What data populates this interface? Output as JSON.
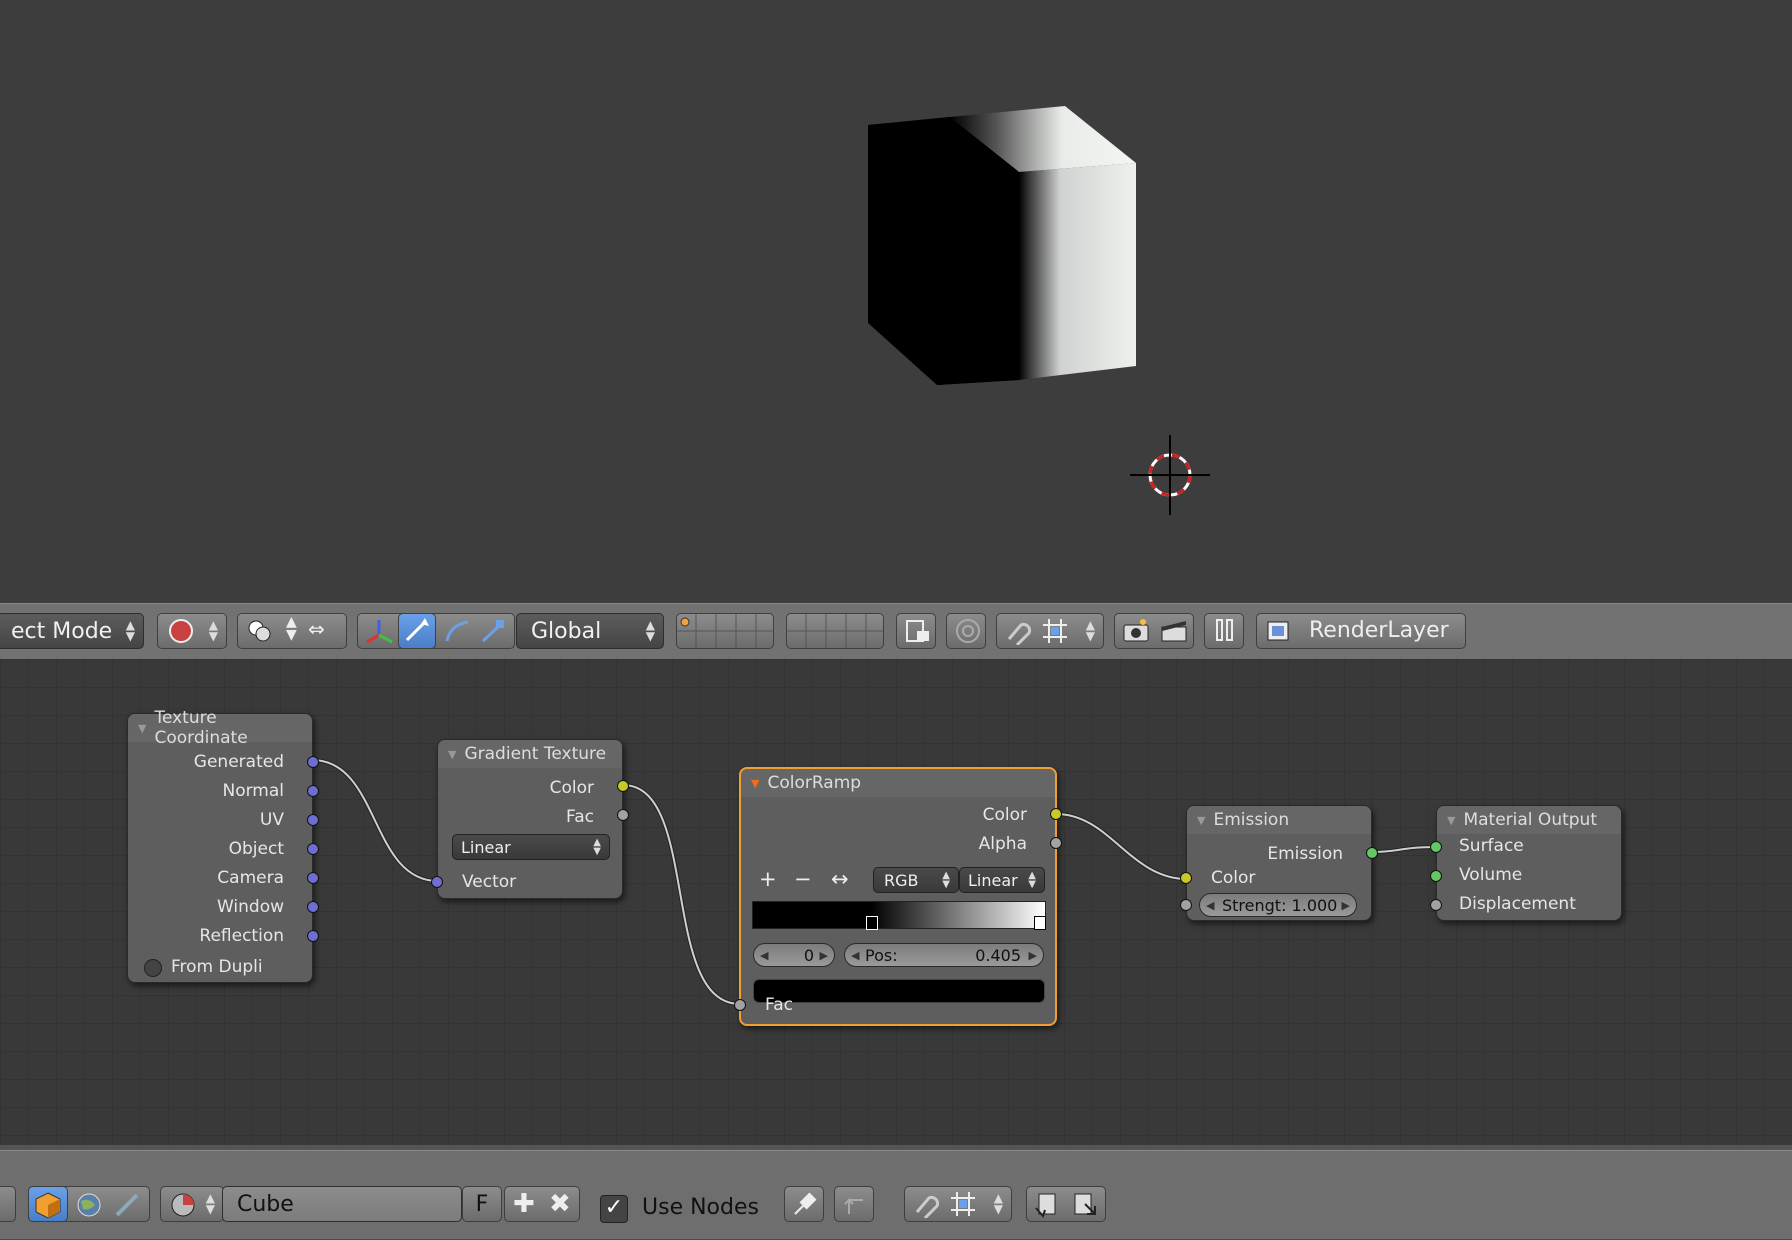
{
  "viewport": {
    "name": "3D Viewport"
  },
  "header3d": {
    "mode": "ect Mode",
    "orientation": "Global",
    "render_layer": "RenderLayer"
  },
  "nodes": {
    "texcoord": {
      "title": "Texture Coordinate",
      "outputs": [
        "Generated",
        "Normal",
        "UV",
        "Object",
        "Camera",
        "Window",
        "Reflection"
      ],
      "from_dupli": "From Dupli"
    },
    "gradient": {
      "title": "Gradient Texture",
      "outputs": [
        "Color",
        "Fac"
      ],
      "type": "Linear",
      "input": "Vector"
    },
    "colorramp": {
      "title": "ColorRamp",
      "outputs": [
        "Color",
        "Alpha"
      ],
      "add": "+",
      "remove": "−",
      "flip": "↔",
      "color_mode": "RGB",
      "interpolation": "Linear",
      "index": "0",
      "pos_label": "Pos:",
      "pos_value": "0.405",
      "input": "Fac",
      "stop_position": 0.405
    },
    "emission": {
      "title": "Emission",
      "output": "Emission",
      "input_color": "Color",
      "strength": "Strengt: 1.000"
    },
    "output": {
      "title": "Material Output",
      "inputs": [
        "Surface",
        "Volume",
        "Displacement"
      ]
    }
  },
  "node_header": {
    "material": "Cube",
    "fake_user": "F",
    "use_nodes": "Use Nodes"
  },
  "colors": {
    "vector_socket": "#6e6ed0",
    "color_socket": "#c8c829",
    "shader_socket": "#63c763",
    "float_socket": "#a2a2a2",
    "active_outline": "#f0a030"
  }
}
